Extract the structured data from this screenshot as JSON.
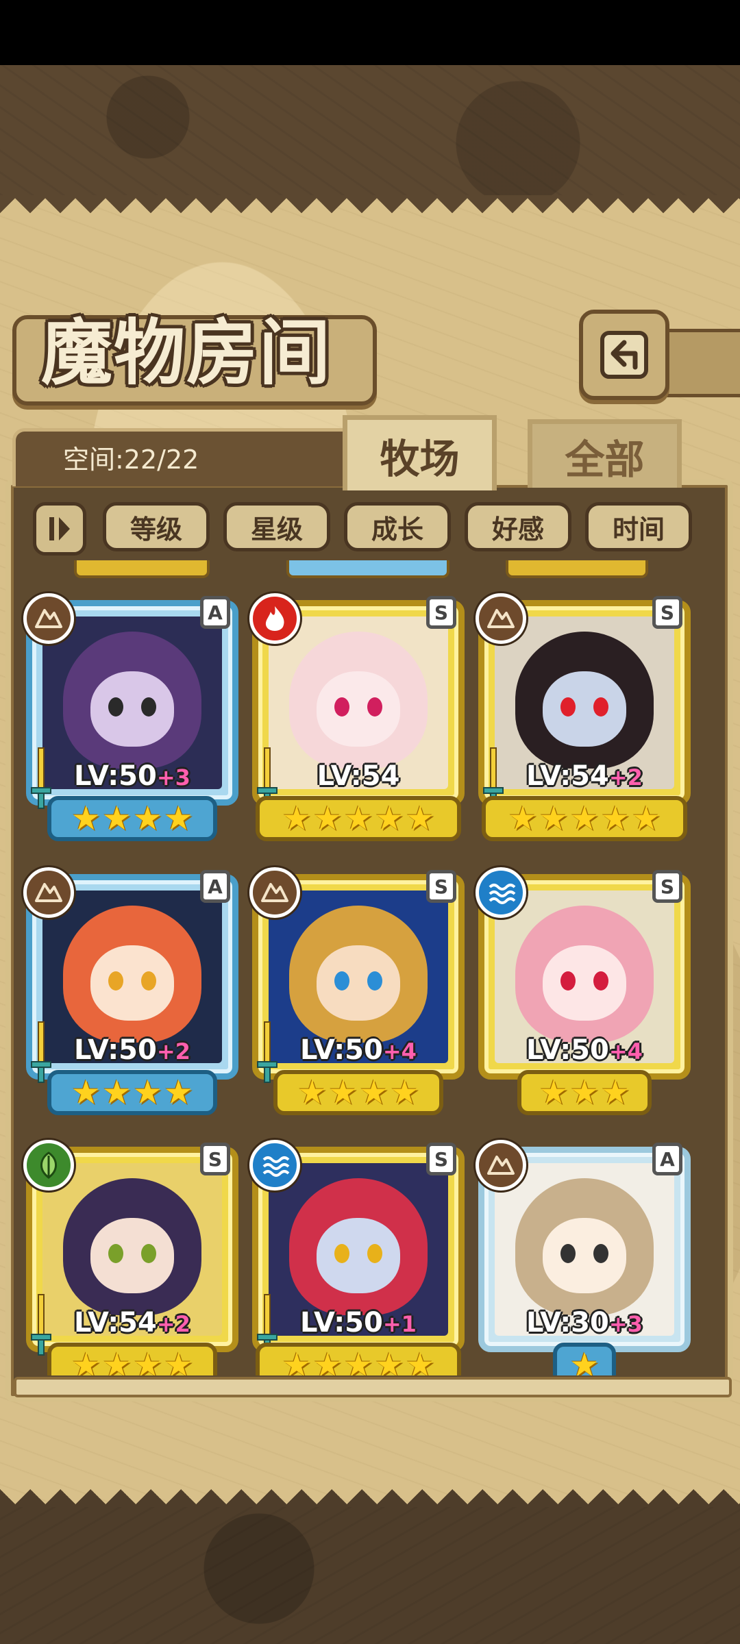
{
  "screen": {
    "title": "魔物房间",
    "space_label": "空间:22/22"
  },
  "tabs": [
    {
      "label": "牧场",
      "active": true
    },
    {
      "label": "全部",
      "active": false
    }
  ],
  "filters": [
    "等级",
    "星级",
    "成长",
    "好感",
    "时间"
  ],
  "monsters": [
    {
      "rank": "A",
      "element": "earth",
      "level": "LV:50",
      "bonus": "+3",
      "stars": 4
    },
    {
      "rank": "S",
      "element": "fire",
      "level": "LV:54",
      "bonus": "",
      "stars": 5
    },
    {
      "rank": "S",
      "element": "earth",
      "level": "LV:54",
      "bonus": "+2",
      "stars": 5
    },
    {
      "rank": "A",
      "element": "earth",
      "level": "LV:50",
      "bonus": "+2",
      "stars": 4
    },
    {
      "rank": "S",
      "element": "earth",
      "level": "LV:50",
      "bonus": "+4",
      "stars": 4
    },
    {
      "rank": "S",
      "element": "water",
      "level": "LV:50",
      "bonus": "+4",
      "stars": 3
    },
    {
      "rank": "S",
      "element": "wind",
      "level": "LV:54",
      "bonus": "+2",
      "stars": 4
    },
    {
      "rank": "S",
      "element": "water",
      "level": "LV:50",
      "bonus": "+1",
      "stars": 5
    },
    {
      "rank": "A",
      "element": "earth",
      "level": "LV:30",
      "bonus": "+3",
      "stars": 1
    }
  ],
  "colors": {
    "parchment": "#d8c08a",
    "panel": "#5e4a2f",
    "level_bonus": "#ff5fae",
    "star": "#ffd21e"
  }
}
